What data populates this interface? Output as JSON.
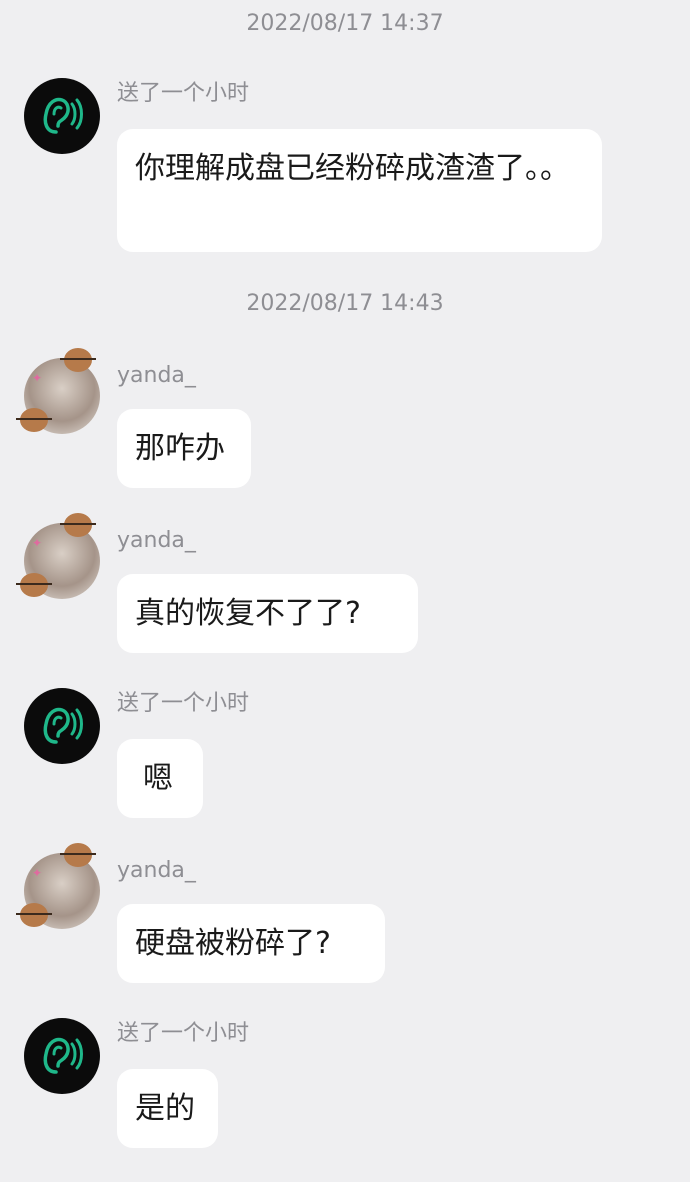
{
  "timestamps": [
    "2022/08/17 14:37",
    "2022/08/17 14:43"
  ],
  "messages": [
    {
      "sender": "送了一个小时",
      "text": "你理解成盘已经粉碎成渣渣了。。",
      "avatar": "ear-icon"
    },
    {
      "sender": "yanda_",
      "text": "那咋办",
      "avatar": "user-photo"
    },
    {
      "sender": "yanda_",
      "text": "真的恢复不了了?",
      "avatar": "user-photo"
    },
    {
      "sender": "送了一个小时",
      "text": "嗯",
      "avatar": "ear-icon"
    },
    {
      "sender": "yanda_",
      "text": "硬盘被粉碎了?",
      "avatar": "user-photo"
    },
    {
      "sender": "送了一个小时",
      "text": "是的",
      "avatar": "ear-icon"
    }
  ],
  "colors": {
    "background": "#efeff1",
    "bubble": "#ffffff",
    "timestamp_text": "#8e8e93",
    "ear_icon_bg": "#0b0b0b",
    "ear_icon_accent": "#1fb88a"
  }
}
